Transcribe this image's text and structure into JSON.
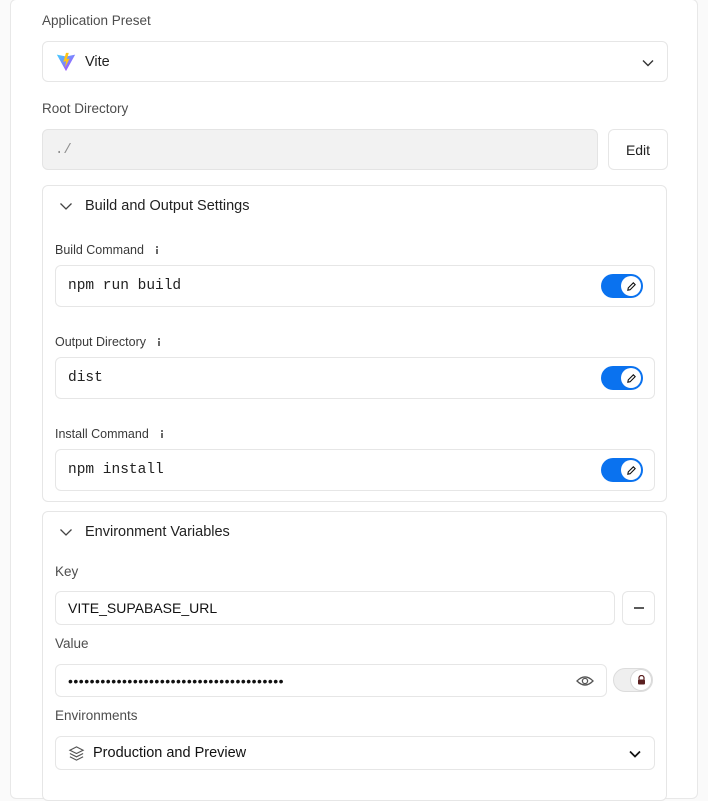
{
  "preset": {
    "label": "Application Preset",
    "value": "Vite"
  },
  "root": {
    "label": "Root Directory",
    "value": "./",
    "edit": "Edit"
  },
  "build_section": {
    "title": "Build and Output Settings",
    "fields": [
      {
        "label": "Build Command",
        "value": "npm run build",
        "override": true
      },
      {
        "label": "Output Directory",
        "value": "dist",
        "override": true
      },
      {
        "label": "Install Command",
        "value": "npm install",
        "override": true
      }
    ]
  },
  "env_section": {
    "title": "Environment Variables",
    "key_label": "Key",
    "key_value": "VITE_SUPABASE_URL",
    "value_label": "Value",
    "value_masked": "••••••••••••••••••••••••••••••••••••••••",
    "sensitive": false,
    "envs_label": "Environments",
    "envs_value": "Production and Preview"
  },
  "icons": {
    "preset_logo": "vite-logo",
    "chevron": "chevron-down-icon",
    "pencil": "pencil-icon",
    "info": "info-icon",
    "eye": "eye-icon",
    "lock": "lock-icon",
    "layers": "layers-icon",
    "minus": "minus-icon"
  },
  "colors": {
    "accent": "#0a72ef",
    "vite_purple": "#8a5cf6",
    "vite_yellow": "#ffc517"
  }
}
